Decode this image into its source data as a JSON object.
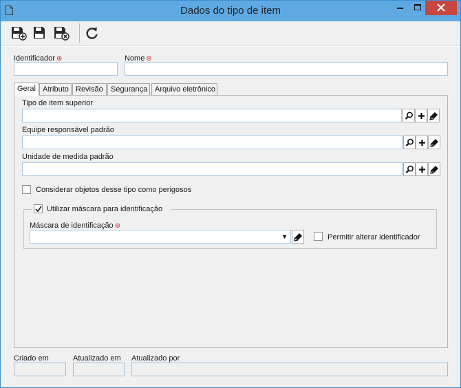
{
  "window": {
    "title": "Dados do tipo de item",
    "icon": "document-icon",
    "controls": [
      "minimize",
      "maximize",
      "close"
    ]
  },
  "toolbar": {
    "buttons": [
      {
        "name": "save-new",
        "icon": "floppy-plus-icon"
      },
      {
        "name": "save",
        "icon": "floppy-icon"
      },
      {
        "name": "save-close",
        "icon": "floppy-x-icon"
      },
      {
        "name": "refresh",
        "icon": "refresh-icon"
      }
    ]
  },
  "header": {
    "identificador_label": "Identificador",
    "identificador_value": "",
    "nome_label": "Nome",
    "nome_value": "",
    "required_mark": "⊛"
  },
  "tabs": [
    {
      "label": "Geral",
      "active": true
    },
    {
      "label": "Atributo",
      "active": false
    },
    {
      "label": "Revisão",
      "active": false
    },
    {
      "label": "Segurança",
      "active": false
    },
    {
      "label": "Arquivo eletrônico",
      "active": false
    }
  ],
  "general": {
    "tipo_superior_label": "Tipo de item superior",
    "tipo_superior_value": "",
    "equipe_label": "Equipe responsável padrão",
    "equipe_value": "",
    "unidade_label": "Unidade de medida padrão",
    "unidade_value": "",
    "perigosos_label": "Considerar objetos desse tipo como perigosos",
    "perigosos_checked": false,
    "mascara_group_label": "Utilizar máscara para identificação",
    "mascara_group_checked": true,
    "mascara_label": "Máscara de identificação",
    "mascara_value": "",
    "permitir_label": "Permitir alterar identificador",
    "permitir_checked": false
  },
  "footer": {
    "criado_label": "Criado em",
    "criado_value": "",
    "atualizado_em_label": "Atualizado em",
    "atualizado_em_value": "",
    "atualizado_por_label": "Atualizado por",
    "atualizado_por_value": ""
  },
  "colors": {
    "titlebar": "#5fa9e3",
    "close_button": "#c7463f",
    "required": "#d62020",
    "field_border": "#a9c6e4"
  }
}
